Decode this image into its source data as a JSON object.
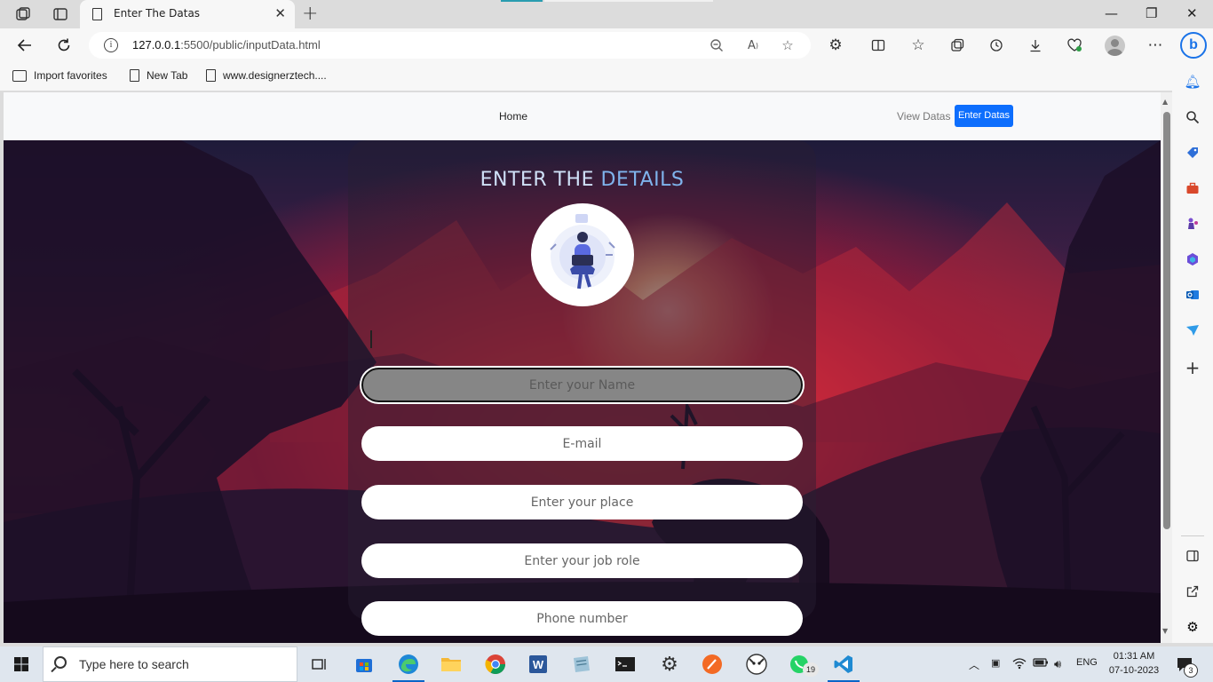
{
  "browser": {
    "tab_title": "Enter The Datas",
    "url_host": "127.0.0.1",
    "url_path": ":5500/public/inputData.html",
    "favorites": [
      {
        "label": "Import favorites"
      },
      {
        "label": "New Tab"
      },
      {
        "label": "www.designerztech...."
      }
    ]
  },
  "site": {
    "nav": {
      "home": "Home",
      "view_datas": "View Datas",
      "enter_datas": "Enter Datas"
    },
    "form": {
      "title_part1": "ENTER THE ",
      "title_part2": "DETAILS",
      "fields": [
        {
          "placeholder": "Enter your Name",
          "focused": true
        },
        {
          "placeholder": "E-mail"
        },
        {
          "placeholder": "Enter your place"
        },
        {
          "placeholder": "Enter your job role"
        },
        {
          "placeholder": "Phone number"
        }
      ]
    }
  },
  "taskbar": {
    "search_placeholder": "Type here to search",
    "language": "ENG",
    "time": "01:31 AM",
    "date": "07-10-2023",
    "whatsapp_badge": "19",
    "notification_badge": "3"
  },
  "colors": {
    "primary_button": "#0d6efd",
    "title_light": "#cfe0f7",
    "title_accent": "#7fb3ec"
  }
}
